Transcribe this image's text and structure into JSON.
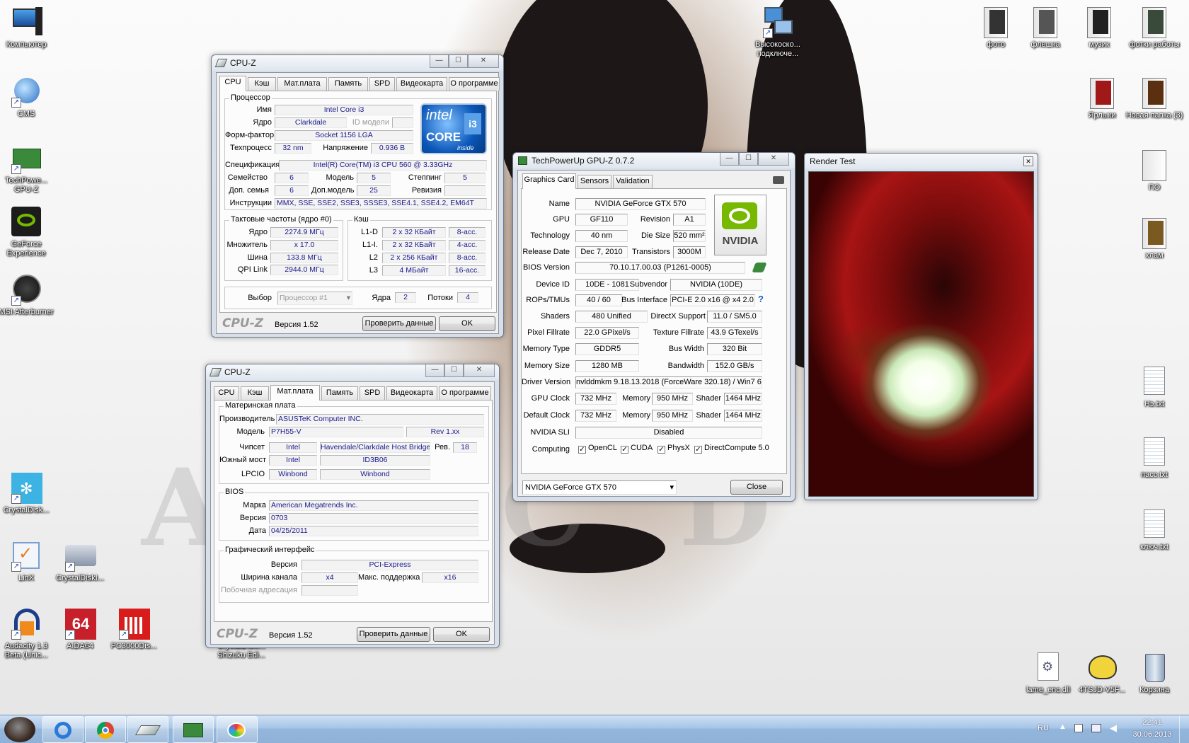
{
  "desktop": {
    "icons": [
      {
        "label": "Компьютер",
        "icon": "computer-icon"
      },
      {
        "label": "CMS",
        "icon": "cms-icon"
      },
      {
        "label": "TechPowe... GPU-Z",
        "icon": "gpuz-icon"
      },
      {
        "label": "GeForce Experience",
        "icon": "geforce-icon"
      },
      {
        "label": "MSI Afterburner",
        "icon": "afterburner-icon"
      },
      {
        "label": "CrystalDisk...",
        "icon": "crystaldisk-icon"
      },
      {
        "label": "LinX",
        "icon": "linx-icon"
      },
      {
        "label": "CrystalDiskI...",
        "icon": "crystaldiskinfo-icon"
      },
      {
        "label": "Audacity 1.3 Beta (Unic...",
        "icon": "audacity-icon"
      },
      {
        "label": "AIDA64",
        "icon": "aida64-icon"
      },
      {
        "label": "PC3000Dis...",
        "icon": "pc3000-icon"
      },
      {
        "label": "CrystalDiskI... Shizuku Edi...",
        "icon": "crystaldisk-shizuku-icon"
      },
      {
        "label": "Высокоско... подключе...",
        "icon": "network-icon"
      },
      {
        "label": "фото",
        "icon": "folder-icon"
      },
      {
        "label": "флешка",
        "icon": "folder-icon"
      },
      {
        "label": "музик",
        "icon": "folder-icon"
      },
      {
        "label": "фотки работы",
        "icon": "folder-icon"
      },
      {
        "label": "Ярлыки",
        "icon": "folder-icon"
      },
      {
        "label": "Новая папка (3)",
        "icon": "folder-icon"
      },
      {
        "label": "ПО",
        "icon": "folder-icon"
      },
      {
        "label": "хлам",
        "icon": "folder-icon"
      },
      {
        "label": "Нэ.txt",
        "icon": "text-file-icon"
      },
      {
        "label": "пасс.txt",
        "icon": "text-file-icon"
      },
      {
        "label": "ключ.txt",
        "icon": "text-file-icon"
      },
      {
        "label": "lame_enc.dll",
        "icon": "dll-file-icon"
      },
      {
        "label": "4TSJD-V5F...",
        "icon": "troll-face-icon"
      },
      {
        "label": "Корзина",
        "icon": "recycle-bin-icon"
      }
    ]
  },
  "cpuz1": {
    "title": "CPU-Z",
    "tabs": [
      "CPU",
      "Кэш",
      "Мат.плата",
      "Память",
      "SPD",
      "Видеокарта",
      "О программе"
    ],
    "processor": {
      "group": "Процессор",
      "name_label": "Имя",
      "name": "Intel Core i3",
      "core_label": "Ядро",
      "core": "Clarkdale",
      "model_id_label": "ID модели",
      "model_id": "",
      "package_label": "Форм-фактор",
      "package": "Socket 1156 LGA",
      "tech_label": "Техпроцесс",
      "tech": "32 nm",
      "voltage_label": "Напряжение",
      "voltage": "0.936 В",
      "spec_label": "Спецификация",
      "spec": "Intel(R) Core(TM) i3 CPU       560  @ 3.33GHz",
      "family_label": "Семейство",
      "family": "6",
      "model_label": "Модель",
      "model": "5",
      "stepping_label": "Степпинг",
      "stepping": "5",
      "ext_family_label": "Доп. семья",
      "ext_family": "6",
      "ext_model_label": "Доп.модель",
      "ext_model": "25",
      "revision_label": "Ревизия",
      "revision": "",
      "instr_label": "Инструкции",
      "instr": "MMX, SSE, SSE2, SSE3, SSSE3, SSE4.1, SSE4.2, EM64T"
    },
    "logo": {
      "line1": "intel",
      "line2": "CORE",
      "line3": "i3",
      "line4": "inside"
    },
    "clocks": {
      "group": "Тактовые частоты (ядро #0)",
      "core_label": "Ядро",
      "core": "2274.9 МГц",
      "mult_label": "Множитель",
      "mult": "x 17.0",
      "bus_label": "Шина",
      "bus": "133.8 МГц",
      "qpi_label": "QPI Link",
      "qpi": "2944.0 МГц"
    },
    "cache": {
      "group": "Кэш",
      "rows": [
        {
          "label": "L1-D",
          "size": "2 x 32 КБайт",
          "assoc": "8-асс."
        },
        {
          "label": "L1-I.",
          "size": "2 x 32 КБайт",
          "assoc": "4-асс."
        },
        {
          "label": "L2",
          "size": "2 x 256 КБайт",
          "assoc": "8-асс."
        },
        {
          "label": "L3",
          "size": "4 МБайт",
          "assoc": "16-асс."
        }
      ]
    },
    "select_label": "Выбор",
    "select_value": "Процессор #1",
    "cores_label": "Ядра",
    "cores": "2",
    "threads_label": "Потоки",
    "threads": "4",
    "brand": "CPU-Z",
    "version": "Версия 1.52",
    "validate": "Проверить данные",
    "ok": "OK"
  },
  "cpuz2": {
    "title": "CPU-Z",
    "tabs": [
      "CPU",
      "Кэш",
      "Мат.плата",
      "Память",
      "SPD",
      "Видеокарта",
      "О программе"
    ],
    "mb": {
      "group": "Материнская плата",
      "maker_label": "Производитель",
      "maker": "ASUSTeK Computer INC.",
      "model_label": "Модель",
      "model": "P7H55-V",
      "rev": "Rev 1.xx",
      "chipset_label": "Чипсет",
      "chipset_vendor": "Intel",
      "chipset": "Havendale/Clarkdale Host Bridge",
      "rev_label": "Рев.",
      "chipset_rev": "18",
      "sb_label": "Южный мост",
      "sb_vendor": "Intel",
      "sb": "ID3B06",
      "lpcio_label": "LPCIO",
      "lpcio_vendor": "Winbond",
      "lpcio": "Winbond"
    },
    "bios": {
      "group": "BIOS",
      "brand_label": "Марка",
      "brand": "American Megatrends Inc.",
      "version_label": "Версия",
      "version": "0703",
      "date_label": "Дата",
      "date": "04/25/2011"
    },
    "gfx": {
      "group": "Графический интерфейс",
      "version_label": "Версия",
      "version": "PCI-Express",
      "width_label": "Ширина канала",
      "width": "x4",
      "max_label": "Макс. поддержка",
      "max": "x16",
      "side_label": "Побочная адресация",
      "side": ""
    },
    "brand": "CPU-Z",
    "version": "Версия 1.52",
    "validate": "Проверить данные",
    "ok": "OK"
  },
  "gpuz": {
    "title": "TechPowerUp GPU-Z 0.7.2",
    "tabs": [
      "Graphics Card",
      "Sensors",
      "Validation"
    ],
    "logo": "NVIDIA",
    "name_label": "Name",
    "name": "NVIDIA GeForce GTX 570",
    "gpu_label": "GPU",
    "gpu": "GF110",
    "revision_label": "Revision",
    "revision": "A1",
    "tech_label": "Technology",
    "tech": "40 nm",
    "die_label": "Die Size",
    "die": "520 mm²",
    "release_label": "Release Date",
    "release": "Dec 7, 2010",
    "transistors_label": "Transistors",
    "transistors": "3000M",
    "bios_label": "BIOS Version",
    "bios": "70.10.17.00.03 (P1261-0005)",
    "devid_label": "Device ID",
    "devid": "10DE - 1081",
    "subvendor_label": "Subvendor",
    "subvendor": "NVIDIA (10DE)",
    "rops_label": "ROPs/TMUs",
    "rops": "40 / 60",
    "bus_label": "Bus Interface",
    "bus": "PCI-E 2.0 x16 @ x4 2.0",
    "shaders_label": "Shaders",
    "shaders": "480 Unified",
    "dx_label": "DirectX Support",
    "dx": "11.0 / SM5.0",
    "pixel_label": "Pixel Fillrate",
    "pixel": "22.0 GPixel/s",
    "texture_label": "Texture Fillrate",
    "texture": "43.9 GTexel/s",
    "memtype_label": "Memory Type",
    "memtype": "GDDR5",
    "buswidth_label": "Bus Width",
    "buswidth": "320 Bit",
    "memsize_label": "Memory Size",
    "memsize": "1280 MB",
    "bandwidth_label": "Bandwidth",
    "bandwidth": "152.0 GB/s",
    "driver_label": "Driver Version",
    "driver": "nvlddmkm 9.18.13.2018 (ForceWare 320.18) / Win7 64",
    "gpuclock_label": "GPU Clock",
    "gpuclock": "732 MHz",
    "memory_label": "Memory",
    "memclock": "950 MHz",
    "shader_label": "Shader",
    "shaderclock": "1464 MHz",
    "defclock_label": "Default Clock",
    "defclock": "732 MHz",
    "defmem": "950 MHz",
    "defshader": "1464 MHz",
    "sli_label": "NVIDIA SLI",
    "sli": "Disabled",
    "computing_label": "Computing",
    "opencl": "OpenCL",
    "cuda": "CUDA",
    "physx": "PhysX",
    "dcompute": "DirectCompute 5.0",
    "check": "✓",
    "question": "?",
    "select": "NVIDIA GeForce GTX 570",
    "close": "Close"
  },
  "render": {
    "title": "Render Test",
    "close_glyph": "✕"
  },
  "taskbar": {
    "lang": "RU",
    "time": "22:41",
    "date": "30.06.2013"
  }
}
